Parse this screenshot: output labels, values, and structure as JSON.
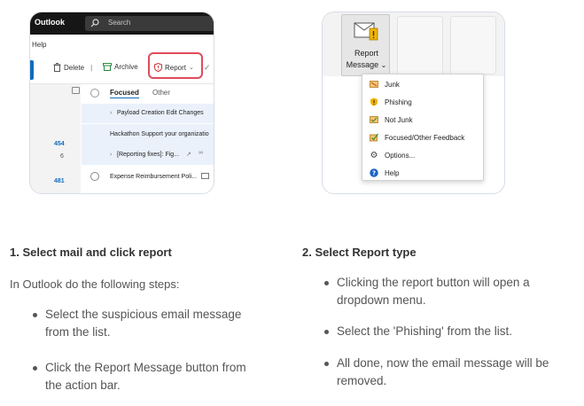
{
  "outlook": {
    "brand": "Outlook",
    "search_placeholder": "Search",
    "help": "Help",
    "toolbar": {
      "delete": "Delete",
      "archive": "Archive",
      "report": "Report"
    },
    "tabs": {
      "focused": "Focused",
      "other": "Other"
    },
    "folder_counts": [
      "454",
      "6",
      "481"
    ],
    "mails": [
      "Payload Creation Edit Changes",
      "Hackathon Support your organizatio",
      "[Reporting fixes]: Fig...",
      "Expense Reimbursement Poli..."
    ]
  },
  "report_menu": {
    "button_line1": "Report",
    "button_line2": "Message",
    "items": [
      "Junk",
      "Phishing",
      "Not Junk",
      "Focused/Other Feedback",
      "Options...",
      "Help"
    ]
  },
  "step1": {
    "heading": "1. Select mail and click report",
    "intro": "In Outlook do the following steps:",
    "bullets": [
      [
        "Select the suspicious email message",
        "from the list."
      ],
      [
        "Click the Report Message button from",
        "the action bar."
      ]
    ]
  },
  "step2": {
    "heading": "2. Select Report type",
    "bullets": [
      [
        "Clicking the report button will open a",
        "dropdown menu."
      ],
      [
        "Select the 'Phishing' from the list."
      ],
      [
        "All done, now the email message will be",
        "removed."
      ]
    ]
  }
}
